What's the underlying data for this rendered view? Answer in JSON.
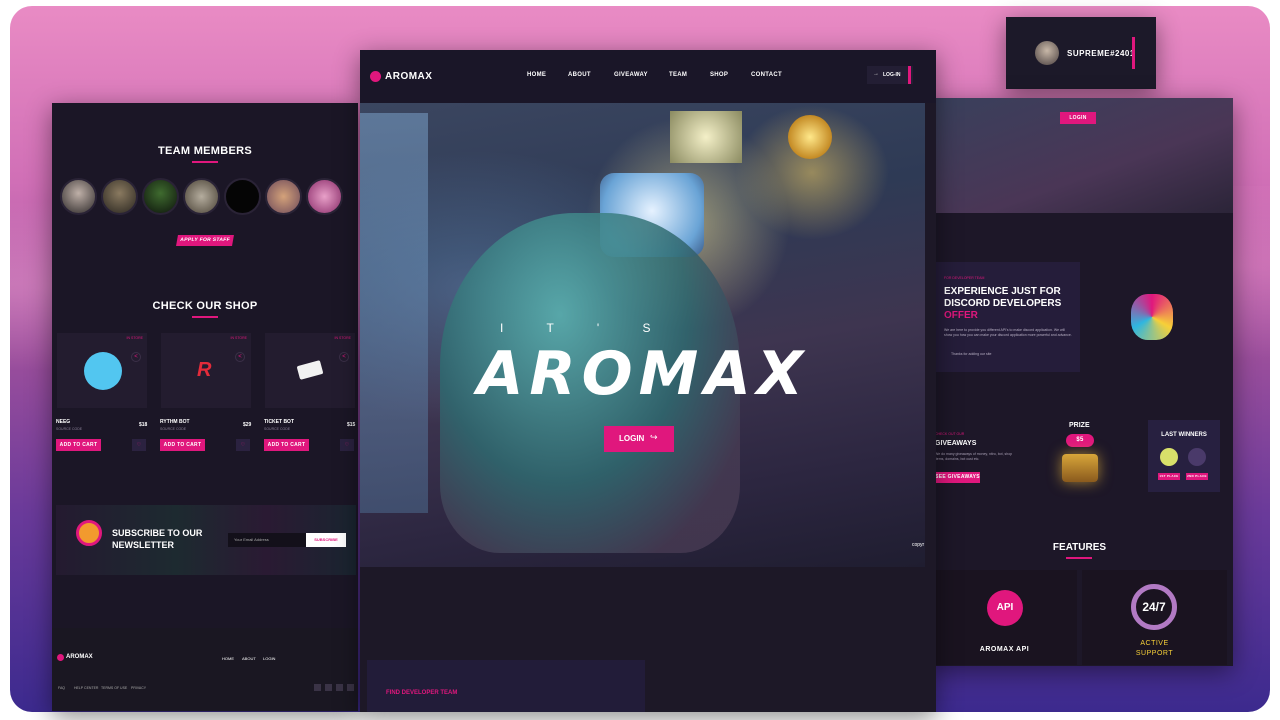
{
  "user": {
    "name": "SUPREME#2401"
  },
  "brand": {
    "name": "AROMAX",
    "accent": "#e0177d"
  },
  "nav": {
    "items": [
      "HOME",
      "ABOUT",
      "GIVEAWAY",
      "TEAM",
      "SHOP",
      "CONTACT"
    ],
    "login": "LOG-IN"
  },
  "hero": {
    "prefix": "I T ' S",
    "title": "AROMAX",
    "login_btn": "LOGIN",
    "credit": "copyr"
  },
  "center_bottom": {
    "find_team": "FIND DEVELOPER TEAM"
  },
  "left": {
    "team_title": "TEAM MEMBERS",
    "apply_btn": "APPLY FOR STAFF",
    "shop_title": "CHECK OUR SHOP",
    "shop_tag": "IN STORE",
    "products": [
      {
        "name": "NEEG",
        "sub": "SOURCE CODE",
        "price": "$18",
        "btn": "ADD TO CART"
      },
      {
        "name": "RYTHM BOT",
        "sub": "SOURCE CODE",
        "price": "$29",
        "btn": "ADD TO CART"
      },
      {
        "name": "TICKET BOT",
        "sub": "SOURCE CODE",
        "price": "$15",
        "btn": "ADD TO CART"
      }
    ],
    "newsletter": {
      "title_1": "SUBSCRIBE TO OUR",
      "title_2": "NEWSLETTER",
      "placeholder": "Your Email Address",
      "btn": "SUBSCRIBE"
    },
    "footer": {
      "brand": "AROMAX",
      "links": [
        "HOME",
        "ABOUT",
        "LOGIN"
      ],
      "bottom_links": [
        "FAQ",
        "HELP CENTER",
        "TERMS OF USE",
        "PRIVACY"
      ]
    }
  },
  "right": {
    "login_btn": "LOGIN",
    "offer": {
      "kicker": "FOR DEVELOPER TEAM",
      "title_1": "EXPERIENCE JUST FOR",
      "title_2": "DISCORD DEVELOPERS",
      "title_3": "OFFER",
      "body": "We are here to provide you different API's to make discord application. We will show you how you can make your discord application more powerful and advance.",
      "note": "Thanks for adding our site"
    },
    "giveaway": {
      "kicker": "CHECK OUT OUR",
      "title": "GIVEAWAYS",
      "body": "We do many giveaways of money, nitro, bot, shop items, domains, bot cust etc.",
      "btn": "SEE GIVEAWAYS"
    },
    "prize": {
      "title": "PRIZE",
      "value": "$5"
    },
    "winners": {
      "title": "LAST WINNERS",
      "first": "1ST PLACE",
      "second": "2ND PLACE"
    },
    "features": {
      "title": "FEATURES",
      "api_label": "AROMAX API",
      "api_badge": "API",
      "support_big": "24/7",
      "support_1": "ACTIVE",
      "support_2": "SUPPORT"
    }
  }
}
